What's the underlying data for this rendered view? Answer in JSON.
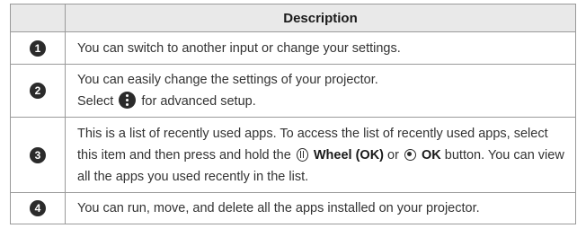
{
  "table": {
    "header": "Description",
    "rows": [
      {
        "num": "1",
        "text": "You can switch to another input or change your settings."
      },
      {
        "num": "2",
        "line1": "You can easily change the settings of your projector.",
        "line2_pre": "Select",
        "line2_icon": "more-options-icon",
        "line2_post": "for advanced setup."
      },
      {
        "num": "3",
        "text_pre": "This is a list of recently used apps. To access the list of recently used apps, select this item and then press and hold the",
        "wheel_icon": "wheel-icon",
        "wheel_label": "Wheel (OK)",
        "or_text": "or",
        "ok_icon": "ok-button-icon",
        "ok_label": "OK",
        "text_post": "button. You can view all the apps you used recently in the list."
      },
      {
        "num": "4",
        "text": "You can run, move, and delete all the apps installed on your projector."
      }
    ]
  }
}
